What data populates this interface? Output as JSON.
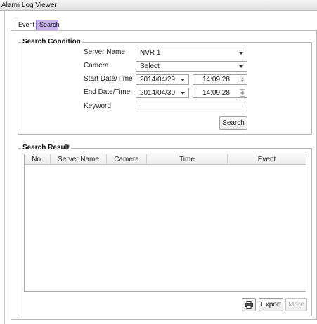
{
  "window": {
    "title": "Alarm Log Viewer"
  },
  "tabs": [
    {
      "label": "Event",
      "active": false
    },
    {
      "label": "Search",
      "active": true
    }
  ],
  "search_condition": {
    "legend": "Search Condition",
    "server_name": {
      "label": "Server Name",
      "value": "NVR 1"
    },
    "camera": {
      "label": "Camera",
      "value": "Select"
    },
    "start": {
      "label": "Start Date/Time",
      "date": "2014/04/29",
      "time": "14:09:28"
    },
    "end": {
      "label": "End Date/Time",
      "date": "2014/04/30",
      "time": "14:09:28"
    },
    "keyword": {
      "label": "Keyword",
      "value": ""
    },
    "search_button": "Search"
  },
  "search_result": {
    "legend": "Search Result",
    "columns": [
      "No.",
      "Server Name",
      "Camera",
      "Time",
      "Event"
    ],
    "rows": []
  },
  "footer": {
    "print_icon": "printer-icon",
    "export_button": "Export",
    "more_button": "More"
  },
  "colors": {
    "active_tab": "#c8b3ef",
    "border": "#b5b5b5"
  }
}
